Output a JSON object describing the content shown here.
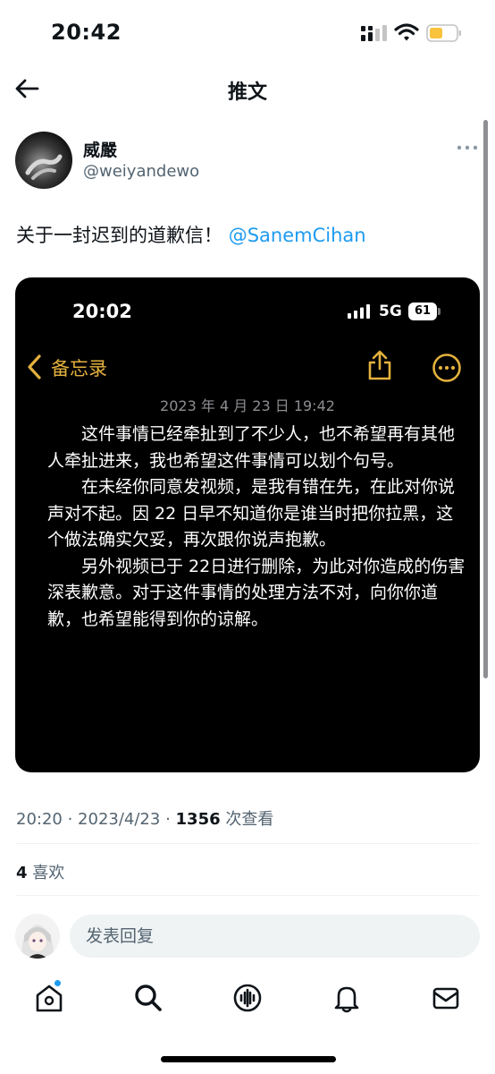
{
  "status_bar": {
    "time": "20:42",
    "battery_color": "#f9c33b"
  },
  "header": {
    "title": "推文",
    "back_icon": "arrow-left-icon"
  },
  "author": {
    "name": "威嚴",
    "handle": "@weiyandewo"
  },
  "tweet": {
    "text": "关于一封迟到的道歉信！",
    "mention": "@SanemCihan"
  },
  "screenshot": {
    "time": "20:02",
    "network": "5G",
    "battery": "61",
    "back_label": "备忘录",
    "accent_color": "#e3b13d",
    "date": "2023 年 4 月 23 日 19:42",
    "paragraphs": [
      "这件事情已经牵扯到了不少人，也不希望再有其他人牵扯进来，我也希望这件事情可以划个句号。",
      "在未经你同意发视频，是我有错在先，在此对你说声对不起。因 22 日早不知道你是谁当时把你拉黑，这个做法确实欠妥，再次跟你说声抱歉。",
      "另外视频已于 22日进行删除，为此对你造成的伤害深表歉意。对于这件事情的处理方法不对，向你你道歉，也希望能得到你的谅解。"
    ]
  },
  "meta": {
    "time": "20:20",
    "date": "2023/4/23",
    "views": "1356",
    "views_label": "次查看"
  },
  "likes": {
    "count": "4",
    "label": "喜欢"
  },
  "reply": {
    "placeholder": "发表回复"
  },
  "tabs": [
    "home",
    "search",
    "spaces",
    "notifications",
    "messages"
  ]
}
